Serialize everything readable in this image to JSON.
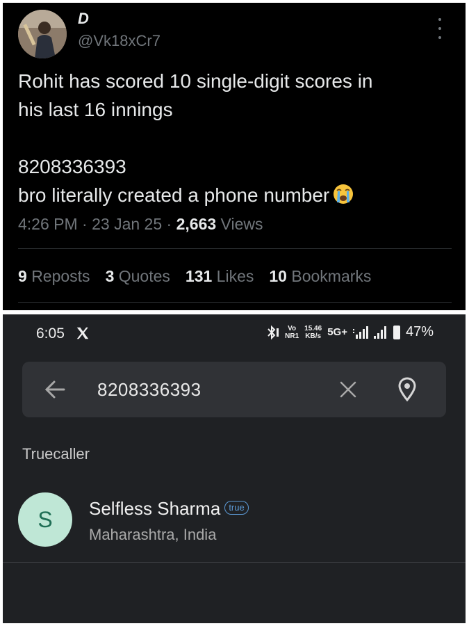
{
  "tweet": {
    "display_name": "D",
    "handle": "@Vk18xCr7",
    "text_line1": "Rohit has scored 10 single-digit scores in",
    "text_line2": "his last 16 innings",
    "text_number": "8208336393",
    "text_line4": "bro literally created a phone number",
    "emoji": "loudly-crying-face-emoji",
    "time": "4:26 PM",
    "date": "23 Jan 25",
    "views_count": "2,663",
    "views_label": "Views",
    "separator": "·",
    "stats": {
      "reposts_count": "9",
      "reposts_label": "Reposts",
      "quotes_count": "3",
      "quotes_label": "Quotes",
      "likes_count": "131",
      "likes_label": "Likes",
      "bookmarks_count": "10",
      "bookmarks_label": "Bookmarks"
    },
    "colors": {
      "background": "#000000",
      "text": "#e7e9ea",
      "muted": "#71767b"
    }
  },
  "phone": {
    "status_bar": {
      "time": "6:05",
      "app_icon": "x-logo-icon",
      "volte_top": "Vo",
      "volte_bottom": "NR1",
      "speed_value": "15.46",
      "speed_unit": "KB/s",
      "network": "5G+",
      "battery": "47%"
    },
    "search": {
      "value": "8208336393",
      "back_icon": "back-arrow-icon",
      "clear_icon": "close-icon",
      "location_icon": "location-pin-icon"
    },
    "section_label": "Truecaller",
    "result": {
      "avatar_letter": "S",
      "name": "Selfless Sharma",
      "badge": "true",
      "location": "Maharashtra, India"
    },
    "colors": {
      "background": "#1f2124",
      "search_bar": "#303236",
      "avatar_bg": "#bfe7d6",
      "badge": "#5c9ad6"
    }
  }
}
